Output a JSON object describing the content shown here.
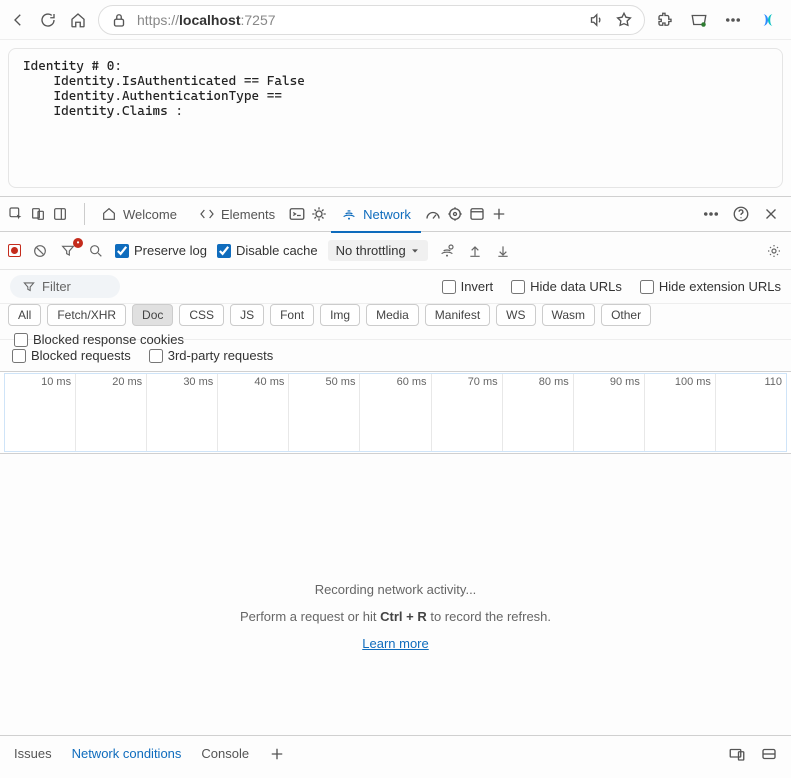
{
  "address": {
    "prefix": "https://",
    "host": "localhost",
    "port": ":7257"
  },
  "page_content": "Identity # 0:\n    Identity.IsAuthenticated == False\n    Identity.AuthenticationType ==\n    Identity.Claims :",
  "devtools_tabs": {
    "welcome": "Welcome",
    "elements": "Elements",
    "network": "Network"
  },
  "network_toolbar": {
    "preserve_log": "Preserve log",
    "disable_cache": "Disable cache",
    "throttling": "No throttling"
  },
  "filter": {
    "placeholder": "Filter",
    "invert": "Invert",
    "hide_data_urls": "Hide data URLs",
    "hide_ext_urls": "Hide extension URLs",
    "blocked_cookies": "Blocked response cookies",
    "blocked_requests": "Blocked requests",
    "third_party": "3rd-party requests"
  },
  "resource_types": [
    "All",
    "Fetch/XHR",
    "Doc",
    "CSS",
    "JS",
    "Font",
    "Img",
    "Media",
    "Manifest",
    "WS",
    "Wasm",
    "Other"
  ],
  "resource_active": "Doc",
  "timeline_labels": [
    "10 ms",
    "20 ms",
    "30 ms",
    "40 ms",
    "50 ms",
    "60 ms",
    "70 ms",
    "80 ms",
    "90 ms",
    "100 ms",
    "110"
  ],
  "recording": {
    "line1": "Recording network activity...",
    "line2a": "Perform a request or hit ",
    "kbd": "Ctrl + R",
    "line2b": " to record the refresh.",
    "learn": "Learn more"
  },
  "drawer": {
    "issues": "Issues",
    "network_conditions": "Network conditions",
    "console": "Console"
  }
}
